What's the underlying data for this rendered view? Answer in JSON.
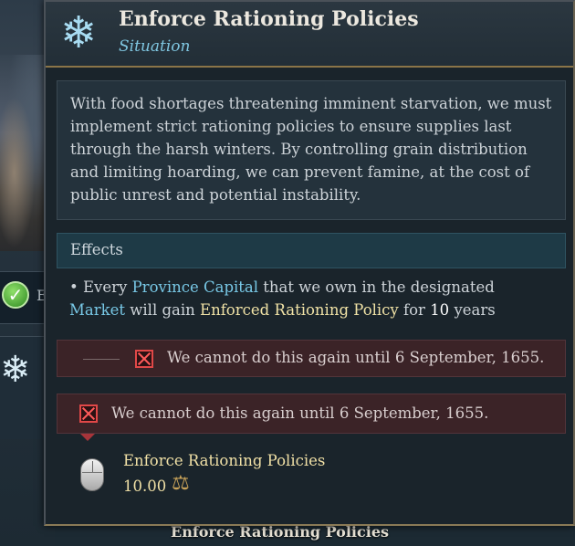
{
  "tooltip": {
    "title": "Enforce Rationing Policies",
    "subtitle": "Situation",
    "icon": "snowflake-icon",
    "description": "With food shortages threatening imminent starvation, we must implement strict rationing policies to ensure supplies last through the harsh winters. By controlling grain distribution and limiting hoarding, we can prevent famine, at the cost of public unrest and potential instability.",
    "effects_header": "Effects",
    "effect": {
      "bullet": "•",
      "every": "Every",
      "target": "Province Capital",
      "mid": "that we own in the designated",
      "market": "Market",
      "gain": "will gain",
      "modifier": "Enforced Rationing Policy",
      "for": "for",
      "duration": "10",
      "unit": "years"
    },
    "conditions": [
      "We cannot do this again until 6 September, 1655.",
      "We cannot do this again until 6 September, 1655."
    ],
    "action": {
      "label": "Enforce Rationing Policies",
      "cost": "10.00",
      "cost_icon": "balance-scale-icon",
      "input_icon": "mouse-icon"
    }
  },
  "background": {
    "check_letter": "E",
    "bottom_label": "Enforce Rationing Policies"
  },
  "colors": {
    "accent_blue": "#78c8e6",
    "accent_gold": "#f0e2a6",
    "fail_red": "#e04848",
    "border_gold": "#8a7448"
  }
}
